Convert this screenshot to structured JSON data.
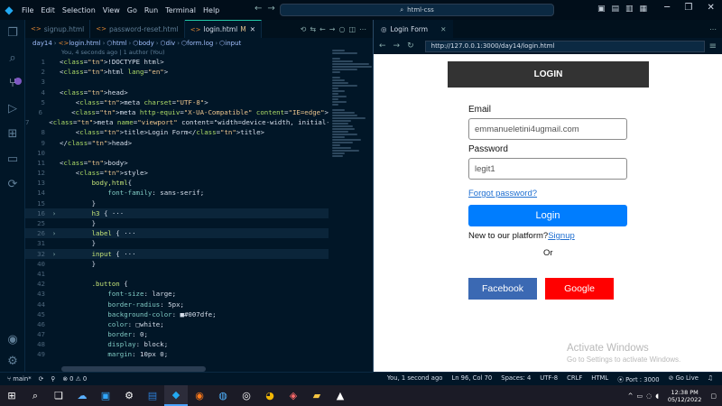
{
  "titlebar": {
    "menus": [
      "File",
      "Edit",
      "Selection",
      "View",
      "Go",
      "Run",
      "Terminal",
      "Help"
    ],
    "command_center": "html-css"
  },
  "tabs": [
    {
      "label": "signup.html",
      "active": false
    },
    {
      "label": "password-reset.html",
      "active": false
    },
    {
      "label": "login.html",
      "active": true,
      "modified": "M"
    }
  ],
  "breadcrumb": [
    "day14",
    "login.html",
    "html",
    "body",
    "div",
    "form.log",
    "input"
  ],
  "blame": "You, 4 seconds ago | 1 author (You)",
  "code_lines": [
    {
      "n": "1",
      "t": "<!DOCTYPE html>"
    },
    {
      "n": "2",
      "t": "<html lang=\"en\">"
    },
    {
      "n": "3",
      "t": ""
    },
    {
      "n": "4",
      "t": "<head>"
    },
    {
      "n": "5",
      "t": "    <meta charset=\"UTF-8\">"
    },
    {
      "n": "6",
      "t": "    <meta http-equiv=\"X-UA-Compatible\" content=\"IE=edge\">"
    },
    {
      "n": "7",
      "t": "    <meta name=\"viewport\" content=\"width=device-width, initial-sc"
    },
    {
      "n": "8",
      "t": "    <title>Login Form</title>"
    },
    {
      "n": "9",
      "t": "</head>"
    },
    {
      "n": "10",
      "t": ""
    },
    {
      "n": "11",
      "t": "<body>"
    },
    {
      "n": "12",
      "t": "    <style>"
    },
    {
      "n": "13",
      "t": "        body,html{"
    },
    {
      "n": "14",
      "t": "            font-family: sans-serif;"
    },
    {
      "n": "15",
      "t": "        }"
    },
    {
      "n": "16",
      "t": "        h3 { ···",
      "fold": true,
      "hl": true
    },
    {
      "n": "25",
      "t": "        }"
    },
    {
      "n": "26",
      "t": "        label { ···",
      "fold": true,
      "hl": true
    },
    {
      "n": "31",
      "t": "        }"
    },
    {
      "n": "32",
      "t": "        input { ···",
      "fold": true,
      "hl": true
    },
    {
      "n": "40",
      "t": "        }"
    },
    {
      "n": "41",
      "t": ""
    },
    {
      "n": "42",
      "t": "        .button {"
    },
    {
      "n": "43",
      "t": "            font-size: large;"
    },
    {
      "n": "44",
      "t": "            border-radius: 5px;"
    },
    {
      "n": "45",
      "t": "            background-color: ■#007dfe;"
    },
    {
      "n": "46",
      "t": "            color: □white;"
    },
    {
      "n": "47",
      "t": "            border: 0;"
    },
    {
      "n": "48",
      "t": "            display: block;"
    },
    {
      "n": "49",
      "t": "            margin: 10px 0;"
    }
  ],
  "browser": {
    "tab_title": "Login Form",
    "url": "http://127.0.0.1:3000/day14/login.html"
  },
  "login": {
    "header": "LOGIN",
    "email_label": "Email",
    "email_value": "emmanueletini4ugmail.com",
    "password_label": "Password",
    "password_value": "legit1",
    "forgot": "Forgot password?",
    "button": "Login",
    "new_to": "New to our platform?",
    "signup": "Signup",
    "or": "Or",
    "facebook": "Facebook",
    "google": "Google",
    "facebook_color": "#3b69b3",
    "google_color": "#ff0000",
    "button_color": "#007dfe"
  },
  "watermark": {
    "title": "Activate Windows",
    "subtitle": "Go to Settings to activate Windows."
  },
  "status": {
    "branch": "main*",
    "problems": "⊗ 0 ⚠ 0",
    "blame": "You, 1 second ago",
    "position": "Ln 96, Col 70",
    "spaces": "Spaces: 4",
    "encoding": "UTF-8",
    "eol": "CRLF",
    "language": "HTML",
    "port": "Port : 3000",
    "golive": "Go Live"
  },
  "clock": {
    "time": "12:38 PM",
    "date": "05/12/2022"
  }
}
